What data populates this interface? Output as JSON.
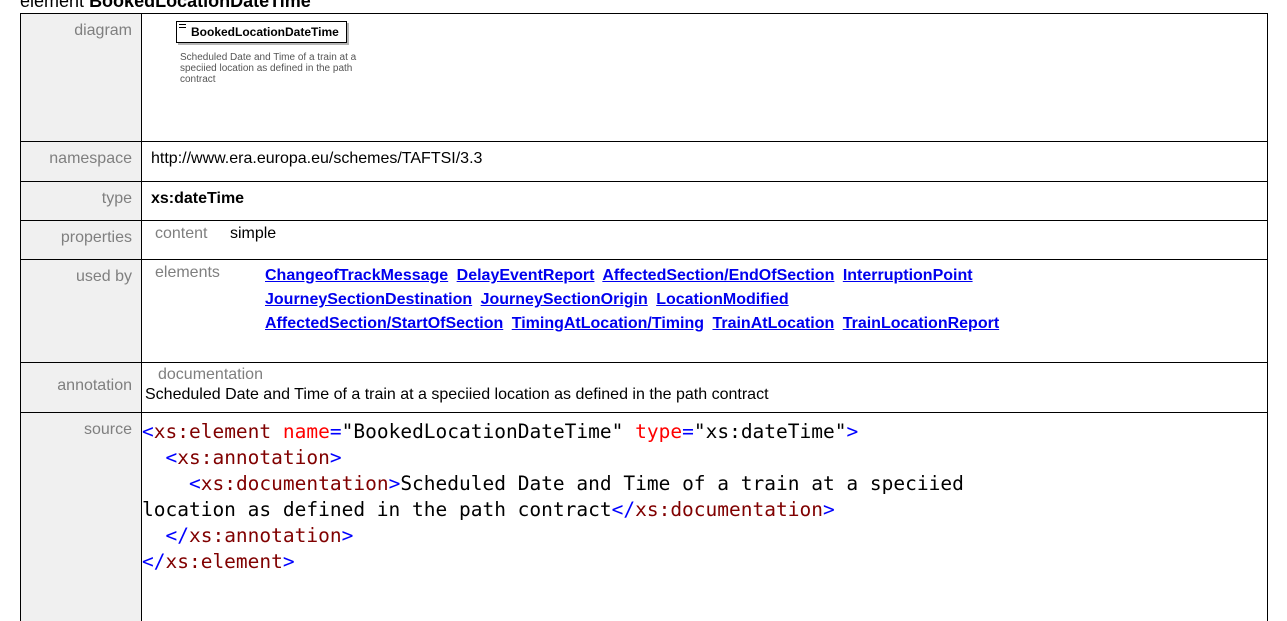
{
  "caption": {
    "prefix": "element",
    "name": "BookedLocationDateTime"
  },
  "rows": {
    "diagram": {
      "label": "diagram",
      "box_title": "BookedLocationDateTime",
      "description": "Scheduled Date and Time of a train at a speciied location as defined in the path contract"
    },
    "namespace": {
      "label": "namespace",
      "value": "http://www.era.europa.eu/schemes/TAFTSI/3.3"
    },
    "type": {
      "label": "type",
      "value": "xs:dateTime"
    },
    "properties": {
      "label": "properties",
      "key": "content",
      "value": "simple"
    },
    "used_by": {
      "label": "used by",
      "key": "elements",
      "links": [
        "ChangeofTrackMessage",
        "DelayEventReport",
        "AffectedSection/EndOfSection",
        "InterruptionPoint",
        "JourneySectionDestination",
        "JourneySectionOrigin",
        "LocationModified",
        "AffectedSection/StartOfSection",
        "TimingAtLocation/Timing",
        "TrainAtLocation",
        "TrainLocationReport"
      ]
    },
    "annotation": {
      "label": "annotation",
      "key": "documentation",
      "text": "Scheduled Date and Time of a train at a speciied location as defined in the path contract"
    },
    "source": {
      "label": "source",
      "element_tag": "xs:element",
      "attr_name": "name",
      "attr_name_value": "\"BookedLocationDateTime\"",
      "attr_type": "type",
      "attr_type_value": "\"xs:dateTime\"",
      "annotation_tag": "xs:annotation",
      "documentation_tag": "xs:documentation",
      "doc_text_line1": "Scheduled Date and Time of a train at a speciied",
      "doc_text_line2": "location as defined in the path contract"
    }
  }
}
